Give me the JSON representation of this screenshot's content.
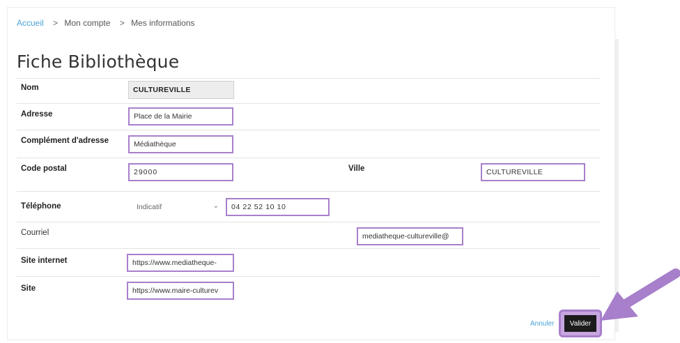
{
  "breadcrumb": {
    "home": "Accueil",
    "separator": ">",
    "account": "Mon compte",
    "current": "Mes informations"
  },
  "page_title": "Fiche Bibliothèque",
  "form": {
    "nom": {
      "label": "Nom",
      "value": "CULTUREVILLE"
    },
    "adresse": {
      "label": "Adresse",
      "value": "Place de la Mairie"
    },
    "complement": {
      "label": "Complément d'adresse",
      "value": "Médiathèque"
    },
    "code_postal": {
      "label": "Code postal",
      "value": "29000"
    },
    "ville": {
      "label": "Ville",
      "value": "CULTUREVILLE"
    },
    "telephone": {
      "label": "Téléphone",
      "indicatif": "Indicatif",
      "value": "04 22 52 10 10"
    },
    "courriel": {
      "label": "Courriel",
      "value": "mediatheque-cultureville@"
    },
    "site_internet": {
      "label": "Site internet",
      "value": "https://www.mediatheque-"
    },
    "site": {
      "label": "Site",
      "value": "https://www.maire-culturev"
    }
  },
  "actions": {
    "cancel": "Annuler",
    "validate": "Valider"
  },
  "colors": {
    "highlight": "#a77fcb",
    "link": "#4aa3d6",
    "button": "#1c1c1c"
  },
  "icons": {
    "select_chevron": "chevron-down-icon",
    "pointer": "arrow-icon"
  }
}
